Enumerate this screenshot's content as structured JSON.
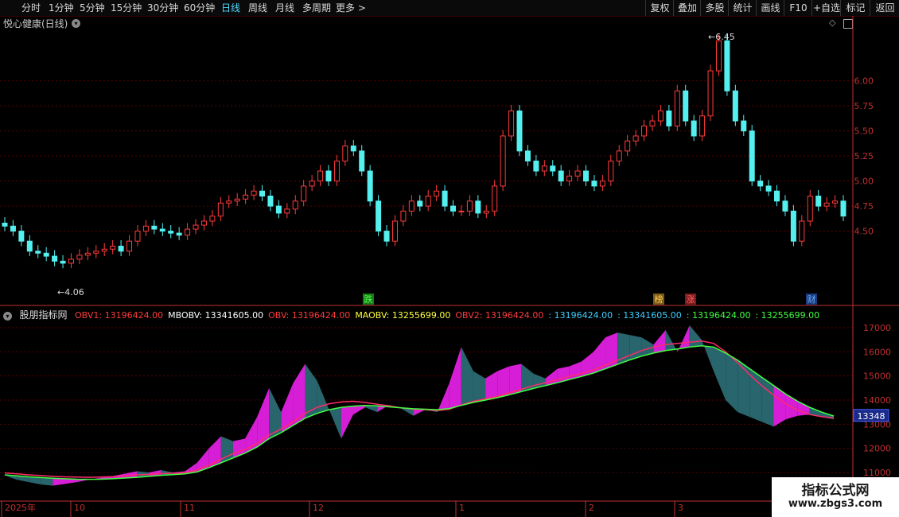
{
  "toolbar": {
    "left_items": [
      "分时",
      "1分钟",
      "5分钟",
      "15分钟",
      "30分钟",
      "60分钟",
      "日线",
      "周线",
      "月线",
      "多周期",
      "更多"
    ],
    "active_item": "日线",
    "right_items": [
      "复权",
      "叠加",
      "多股",
      "统计",
      "画线",
      "F10",
      "+自选",
      "返回"
    ],
    "extra_right": "标记"
  },
  "stock": {
    "title": "悦心健康(日线)"
  },
  "indicator": {
    "name": "股朋指标网",
    "legend": [
      {
        "text": "OBV1: 13196424.00",
        "color": "#ff3b3b"
      },
      {
        "text": "MBOBV: 13341605.00",
        "color": "#ffffff"
      },
      {
        "text": "OBV: 13196424.00",
        "color": "#ff3b3b"
      },
      {
        "text": "MAOBV: 13255699.00",
        "color": "#ffff40"
      },
      {
        "text": "OBV2: 13196424.00",
        "color": "#ff3b3b"
      },
      {
        "text": ": 13196424.00",
        "color": "#3fd0ff"
      },
      {
        "text": ": 13341605.00",
        "color": "#3fd0ff"
      },
      {
        "text": ": 13196424.00",
        "color": "#40ff40"
      },
      {
        "text": ": 13255699.00",
        "color": "#40ff40"
      }
    ],
    "current_tag": "13348"
  },
  "watermark": {
    "line1": "指标公式网",
    "line2": "www.zbgs3.com"
  },
  "colors": {
    "up": "#ff3b3b",
    "down": "#54f0f0",
    "grid": "#5a0000",
    "axis": "#c03030"
  },
  "chart_data": [
    {
      "type": "candlestick",
      "title": "悦心健康(日线)",
      "y_ticks": [
        4.5,
        4.75,
        5.0,
        5.25,
        5.5,
        5.75,
        6.0
      ],
      "ylim": [
        4.06,
        6.45
      ],
      "high_label": "6.45",
      "low_label": "4.06",
      "annotations": [
        "跌",
        "榜",
        "涨",
        "财"
      ],
      "x_labels": [
        "2025年",
        "10",
        "11",
        "12",
        "1",
        "2",
        "3"
      ]
    },
    {
      "type": "line",
      "title": "股朋指标网",
      "y_ticks": [
        11000,
        12000,
        13000,
        14000,
        15000,
        16000,
        17000
      ],
      "series": [
        {
          "name": "OBV",
          "values": [
            10880,
            10700,
            10600,
            10500,
            10450,
            10520,
            10600,
            10700,
            10780,
            10850,
            10950,
            11050,
            11000,
            11100,
            11000,
            11050,
            11400,
            12000,
            12500,
            12300,
            12400,
            13300,
            14500,
            13500,
            14700,
            15500,
            14800,
            13600,
            12400,
            13400,
            13700,
            13500,
            13800,
            13650,
            13350,
            13600,
            13500,
            14700,
            16200,
            15200,
            14900,
            15200,
            15400,
            15500,
            15100,
            14900,
            15300,
            15400,
            15600,
            16000,
            16600,
            16800,
            16700,
            16600,
            16300,
            16900,
            16000,
            17100,
            16500,
            15200,
            14000,
            13500,
            13300,
            13100,
            12900,
            13200,
            13350,
            13400,
            13300,
            13200
          ]
        },
        {
          "name": "MAOBV",
          "values": [
            10980,
            10940,
            10900,
            10870,
            10840,
            10820,
            10810,
            10800,
            10810,
            10830,
            10860,
            10900,
            10920,
            10950,
            10970,
            10990,
            11100,
            11300,
            11550,
            11780,
            11950,
            12200,
            12550,
            12800,
            13100,
            13450,
            13700,
            13850,
            13920,
            13950,
            13900,
            13830,
            13760,
            13680,
            13620,
            13600,
            13560,
            13620,
            13800,
            13950,
            14050,
            14150,
            14300,
            14450,
            14600,
            14720,
            14850,
            14980,
            15100,
            15250,
            15450,
            15650,
            15850,
            16050,
            16200,
            16300,
            16350,
            16400,
            16450,
            16350,
            16000,
            15550,
            15050,
            14600,
            14200,
            13850,
            13580,
            13400,
            13310,
            13256
          ]
        },
        {
          "name": "MBOBV",
          "values": [
            10900,
            10860,
            10820,
            10790,
            10760,
            10740,
            10720,
            10715,
            10720,
            10740,
            10770,
            10800,
            10840,
            10880,
            10910,
            10940,
            11020,
            11200,
            11400,
            11600,
            11800,
            12050,
            12400,
            12650,
            12950,
            13250,
            13450,
            13600,
            13700,
            13750,
            13780,
            13760,
            13720,
            13680,
            13640,
            13620,
            13600,
            13650,
            13780,
            13900,
            14000,
            14100,
            14220,
            14350,
            14480,
            14600,
            14720,
            14850,
            14980,
            15120,
            15300,
            15480,
            15660,
            15820,
            15950,
            16050,
            16120,
            16200,
            16250,
            16200,
            15950,
            15650,
            15300,
            14950,
            14600,
            14250,
            13950,
            13700,
            13500,
            13342
          ]
        }
      ]
    }
  ]
}
